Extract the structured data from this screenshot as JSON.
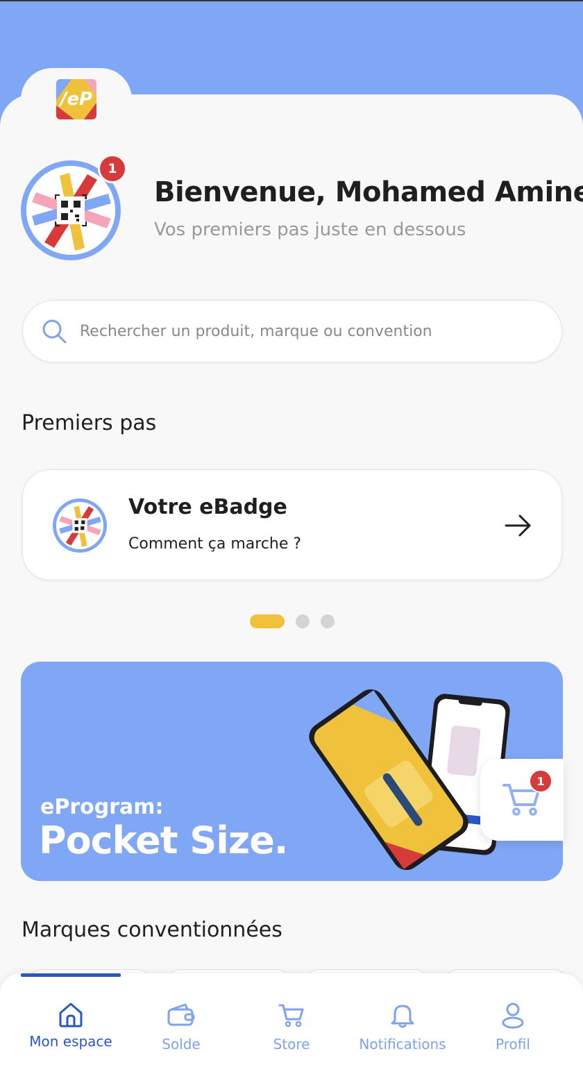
{
  "brand": {
    "logo_text": "/eP"
  },
  "header": {
    "title": "Bienvenue, Mohamed Amine!",
    "subtitle": "Vos premiers pas juste en dessous",
    "notification_count": "1"
  },
  "search": {
    "placeholder": "Rechercher un produit, marque ou convention"
  },
  "first_steps": {
    "title": "Premiers pas",
    "card": {
      "title": "Votre eBadge",
      "subtitle": "Comment ça marche ?"
    },
    "pager": {
      "count": 3,
      "active_index": 0
    }
  },
  "banner": {
    "small": "eProgram:",
    "big": "Pocket Size."
  },
  "cart": {
    "count": "1"
  },
  "brands": {
    "title": "Marques conventionnées"
  },
  "tabbar": {
    "items": [
      {
        "label": "Mon espace",
        "icon": "home-icon",
        "active": true
      },
      {
        "label": "Solde",
        "icon": "wallet-icon",
        "active": false
      },
      {
        "label": "Store",
        "icon": "cart-icon",
        "active": false
      },
      {
        "label": "Notifications",
        "icon": "bell-icon",
        "active": false
      },
      {
        "label": "Profil",
        "icon": "user-icon",
        "active": false
      }
    ]
  },
  "colors": {
    "primary_blue": "#7fa7f5",
    "active_blue": "#2a56c6",
    "yellow": "#f0c23b",
    "red": "#d63a3a",
    "pink": "#f4a6b8"
  }
}
